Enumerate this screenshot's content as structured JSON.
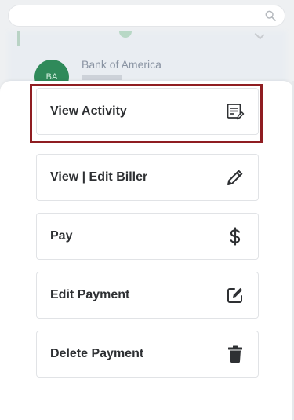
{
  "background": {
    "biller_avatar_text": "BA",
    "biller_name": "Bank of America"
  },
  "search": {
    "placeholder": ""
  },
  "actions": [
    {
      "label": "View Activity",
      "icon": "document-edit-icon"
    },
    {
      "label": "View | Edit Biller",
      "icon": "pencil-icon"
    },
    {
      "label": "Pay",
      "icon": "dollar-icon"
    },
    {
      "label": "Edit Payment",
      "icon": "edit-square-icon"
    },
    {
      "label": "Delete Payment",
      "icon": "trash-icon"
    }
  ],
  "colors": {
    "selection_outline": "#8f1d21",
    "text": "#2e3033",
    "avatar": "#2f8a5a"
  }
}
